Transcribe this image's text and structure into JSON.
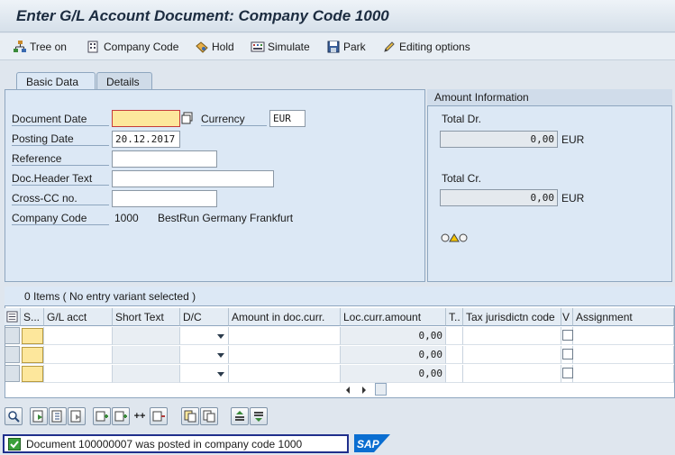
{
  "window": {
    "title": "Enter G/L Account Document: Company Code 1000"
  },
  "toolbar": {
    "tree_on": "Tree on",
    "company_code": "Company Code",
    "hold": "Hold",
    "simulate": "Simulate",
    "park": "Park",
    "editing_options": "Editing options"
  },
  "tabs": {
    "basic_data": "Basic Data",
    "details": "Details"
  },
  "basic": {
    "document_date_label": "Document Date",
    "document_date_value": "",
    "currency_label": "Currency",
    "currency_value": "EUR",
    "posting_date_label": "Posting Date",
    "posting_date_value": "20.12.2017",
    "reference_label": "Reference",
    "reference_value": "",
    "doc_header_label": "Doc.Header Text",
    "doc_header_value": "",
    "cross_cc_label": "Cross-CC no.",
    "cross_cc_value": "",
    "company_code_label": "Company Code",
    "company_code_value": "1000",
    "company_name": "BestRun Germany Frankfurt"
  },
  "amount_info": {
    "header": "Amount Information",
    "total_dr_label": "Total Dr.",
    "total_dr_value": "0,00",
    "total_dr_currency": "EUR",
    "total_cr_label": "Total Cr.",
    "total_cr_value": "0,00",
    "total_cr_currency": "EUR",
    "balance_icon": "traffic-light-icon"
  },
  "items": {
    "caption": "0 Items ( No entry variant selected )",
    "columns": [
      "S...",
      "G/L acct",
      "Short Text",
      "D/C",
      "Amount in doc.curr.",
      "Loc.curr.amount",
      "T..",
      "Tax jurisdictn code",
      "V",
      "Assignment"
    ],
    "rows": [
      {
        "loc_amount": "0,00"
      },
      {
        "loc_amount": "0,00"
      },
      {
        "loc_amount": "0,00"
      }
    ]
  },
  "status": {
    "message": "Document 100000007 was posted in company code 1000"
  },
  "brand": {
    "logo": "SAP",
    "color": "#0a6ed1"
  }
}
